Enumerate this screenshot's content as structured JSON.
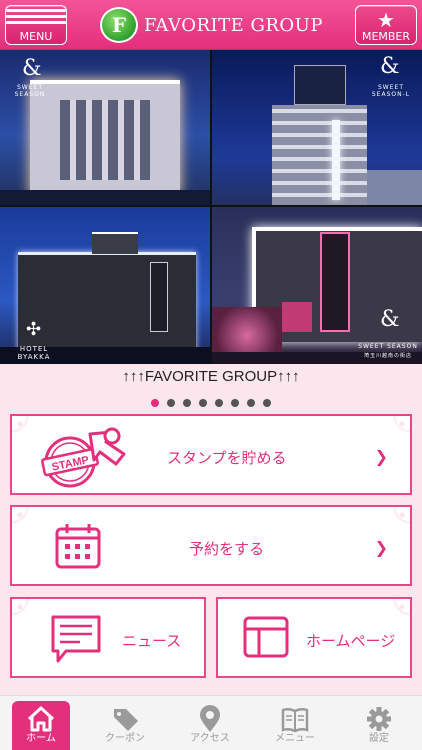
{
  "header": {
    "menu_label": "MENU",
    "member_label": "MEMBER",
    "logo_mark": "F",
    "title": "FAVORITE GROUP"
  },
  "photos": [
    {
      "brand": "SWEET SEASON",
      "sub": "HOTEL"
    },
    {
      "brand": "SWEET SEASON-L",
      "sub": "HOTEL"
    },
    {
      "brand": "HOTEL BYAKKA",
      "sub": ""
    },
    {
      "brand": "SWEET SEASON",
      "sub": "埼玉川越南の街店"
    }
  ],
  "carousel": {
    "caption": "↑↑↑FAVORITE GROUP↑↑↑",
    "dot_count": 8,
    "active_index": 0
  },
  "menu": {
    "stamp_label": "スタンプを貯める",
    "stamp_icon_text": "STAMP",
    "reserve_label": "予約をする",
    "news_label": "ニュース",
    "homepage_label": "ホームページ"
  },
  "tabs": [
    {
      "label": "ホーム",
      "icon": "home-icon",
      "active": true
    },
    {
      "label": "クーポン",
      "icon": "coupon-icon",
      "active": false
    },
    {
      "label": "アクセス",
      "icon": "map-pin-icon",
      "active": false
    },
    {
      "label": "メニュー",
      "icon": "book-icon",
      "active": false
    },
    {
      "label": "設定",
      "icon": "gear-icon",
      "active": false
    }
  ],
  "colors": {
    "accent": "#e42f7d",
    "background": "#fbe6ee",
    "tab_inactive": "#9a9a9a"
  }
}
